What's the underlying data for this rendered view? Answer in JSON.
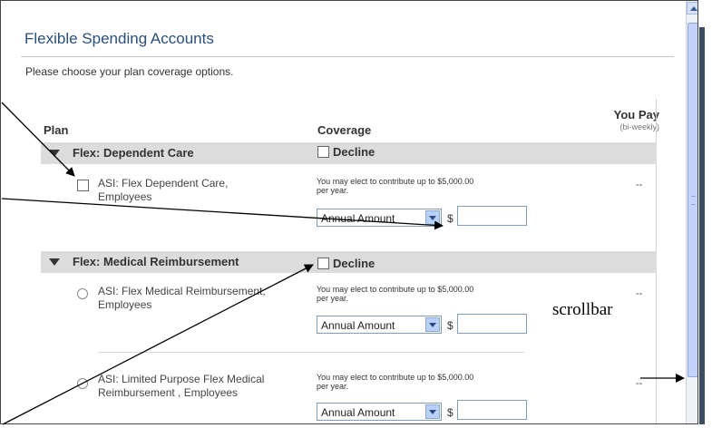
{
  "page": {
    "title": "Flexible Spending Accounts",
    "subtitle": "Please choose your plan coverage options."
  },
  "columns": {
    "plan": "Plan",
    "coverage": "Coverage",
    "you_pay": "You Pay",
    "you_pay_sub": "(bi-weekly)"
  },
  "groups": [
    {
      "label": "Flex: Dependent Care",
      "decline_label": "Decline",
      "options": [
        {
          "control": "checkbox",
          "label_line1": "ASI: Flex Dependent Care,",
          "label_line2": "Employees",
          "note_line1": "You may elect to contribute up to $5,000.00",
          "note_line2": "per year.",
          "select_value": "Annual Amount",
          "currency": "$",
          "amount": "",
          "you_pay": "--"
        }
      ]
    },
    {
      "label": "Flex: Medical Reimbursement",
      "decline_label": "Decline",
      "options": [
        {
          "control": "radio",
          "label_line1": "ASI: Flex Medical Reimbursement,",
          "label_line2": "Employees",
          "note_line1": "You may elect to contribute up to $5,000.00",
          "note_line2": "per year.",
          "select_value": "Annual Amount",
          "currency": "$",
          "amount": "",
          "you_pay": "--"
        },
        {
          "control": "radio",
          "label_line1": "ASI: Limited Purpose Flex Medical",
          "label_line2": "Reimbursement , Employees",
          "note_line1": "You may elect to contribute up to $5,000.00",
          "note_line2": "per year.",
          "select_value": "Annual Amount",
          "currency": "$",
          "amount": "",
          "you_pay": "--"
        }
      ]
    }
  ],
  "annotation": {
    "scrollbar_label": "scrollbar"
  },
  "colors": {
    "title": "#2a4f7a",
    "group_bar": "#dcdcdc",
    "scrollbar_thumb": "#c3d3fb"
  }
}
